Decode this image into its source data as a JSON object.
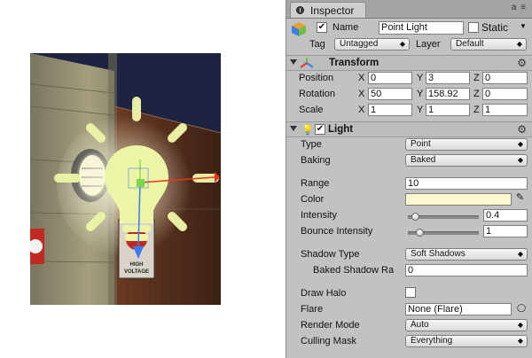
{
  "inspector": {
    "tab_title": "Inspector",
    "tab_tools": "a ≡",
    "object": {
      "name_label": "Name",
      "name_value": "Point Light",
      "static_label": "Static",
      "tag_label": "Tag",
      "tag_value": "Untagged",
      "layer_label": "Layer",
      "layer_value": "Default"
    },
    "transform": {
      "title": "Transform",
      "rows": [
        {
          "label": "Position",
          "x": "0",
          "y": "3",
          "z": "0"
        },
        {
          "label": "Rotation",
          "x": "50",
          "y": "158.92",
          "z": "0"
        },
        {
          "label": "Scale",
          "x": "1",
          "y": "1",
          "z": "1"
        }
      ],
      "axis_x": "X",
      "axis_y": "Y",
      "axis_z": "Z"
    },
    "light": {
      "title": "Light",
      "type_label": "Type",
      "type_value": "Point",
      "baking_label": "Baking",
      "baking_value": "Baked",
      "range_label": "Range",
      "range_value": "10",
      "color_label": "Color",
      "color_swatch": "#fff7cf",
      "intensity_label": "Intensity",
      "intensity_value": "0.4",
      "intensity_level": 0.05,
      "bounce_label": "Bounce Intensity",
      "bounce_value": "1",
      "bounce_level": 0.125,
      "shadow_type_label": "Shadow Type",
      "shadow_type_value": "Soft Shadows",
      "baked_shadow_label": "Baked Shadow Ra",
      "baked_shadow_value": "0",
      "draw_halo_label": "Draw Halo",
      "flare_label": "Flare",
      "flare_value": "None (Flare)",
      "render_mode_label": "Render Mode",
      "render_mode_value": "Auto",
      "culling_label": "Culling Mask",
      "culling_value": "Everything"
    }
  },
  "scene": {
    "signs": [
      "HIGH",
      "VOLTAGE"
    ],
    "colors": {
      "bulb": "#ecf4a6",
      "axis_x": "#e8321e",
      "axis_y": "#3c7cf0",
      "axis_z": "#7ad64a"
    }
  }
}
